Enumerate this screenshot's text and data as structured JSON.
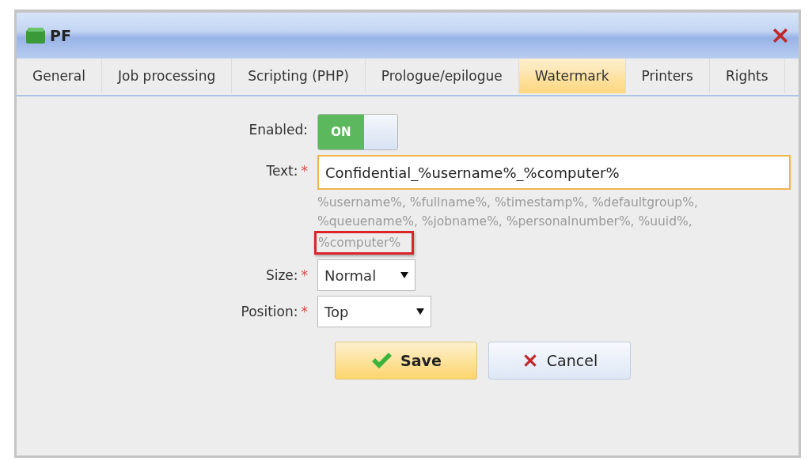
{
  "window": {
    "title": "PF"
  },
  "tabs": [
    {
      "label": "General",
      "selected": false
    },
    {
      "label": "Job processing",
      "selected": false
    },
    {
      "label": "Scripting (PHP)",
      "selected": false
    },
    {
      "label": "Prologue/epilogue",
      "selected": false
    },
    {
      "label": "Watermark",
      "selected": true
    },
    {
      "label": "Printers",
      "selected": false
    },
    {
      "label": "Rights",
      "selected": false
    }
  ],
  "form": {
    "enabled": {
      "label": "Enabled:",
      "on": true,
      "on_text": "ON"
    },
    "text": {
      "label": "Text:",
      "required_mark": "*",
      "value": "Confidential_%username%_%computer%",
      "hint": "%username%, %fullname%, %timestamp%, %defaultgroup%, %queuename%, %jobname%, %personalnumber%, %uuid%,",
      "highlighted_hint": "%computer%"
    },
    "size": {
      "label": "Size:",
      "required_mark": "*",
      "value": "Normal"
    },
    "position": {
      "label": "Position:",
      "required_mark": "*",
      "value": "Top"
    }
  },
  "buttons": [
    {
      "kind": "save",
      "label": "Save"
    },
    {
      "kind": "cancel",
      "label": "Cancel"
    }
  ]
}
